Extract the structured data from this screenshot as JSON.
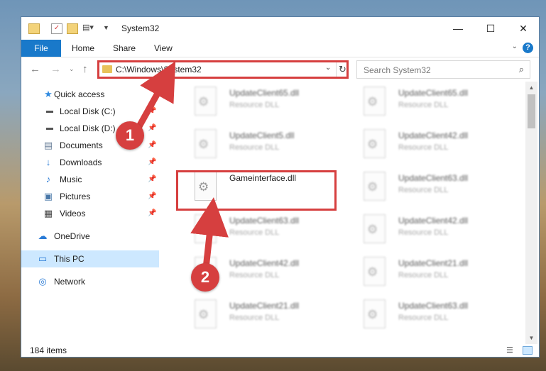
{
  "window": {
    "title": "System32"
  },
  "ribbon": {
    "file": "File",
    "tabs": [
      "Home",
      "Share",
      "View"
    ],
    "help": "?"
  },
  "address": {
    "path": "C:\\Windows\\System32",
    "search_placeholder": "Search System32"
  },
  "nav": {
    "items": [
      {
        "label": "Quick access",
        "icon": "star-icon",
        "pinned": false,
        "selected": false
      },
      {
        "label": "Local Disk (C:)",
        "icon": "drive-icon",
        "pinned": true,
        "selected": false
      },
      {
        "label": "Local Disk (D:)",
        "icon": "drive-icon",
        "pinned": true,
        "selected": false
      },
      {
        "label": "Documents",
        "icon": "document-icon",
        "pinned": true,
        "selected": false
      },
      {
        "label": "Downloads",
        "icon": "download-icon",
        "pinned": true,
        "selected": false
      },
      {
        "label": "Music",
        "icon": "music-icon",
        "pinned": true,
        "selected": false
      },
      {
        "label": "Pictures",
        "icon": "picture-icon",
        "pinned": true,
        "selected": false
      },
      {
        "label": "Videos",
        "icon": "video-icon",
        "pinned": true,
        "selected": false
      },
      {
        "label": "OneDrive",
        "icon": "cloud-icon",
        "pinned": false,
        "selected": false
      },
      {
        "label": "This PC",
        "icon": "computer-icon",
        "pinned": false,
        "selected": true
      },
      {
        "label": "Network",
        "icon": "network-icon",
        "pinned": false,
        "selected": false
      }
    ]
  },
  "files": [
    {
      "name": "UpdateClient65.dll",
      "desc": "Resource DLL",
      "blurred": true
    },
    {
      "name": "UpdateClient65.dll",
      "desc": "Resource DLL",
      "blurred": true
    },
    {
      "name": "UpdateClient5.dll",
      "desc": "Resource DLL",
      "blurred": true
    },
    {
      "name": "UpdateClient42.dll",
      "desc": "Resource DLL",
      "blurred": true
    },
    {
      "name": "Gameinterface.dll",
      "desc": "",
      "blurred": false
    },
    {
      "name": "UpdateClient63.dll",
      "desc": "Resource DLL",
      "blurred": true
    },
    {
      "name": "UpdateClient63.dll",
      "desc": "Resource DLL",
      "blurred": true
    },
    {
      "name": "UpdateClient42.dll",
      "desc": "Resource DLL",
      "blurred": true
    },
    {
      "name": "UpdateClient42.dll",
      "desc": "Resource DLL",
      "blurred": true
    },
    {
      "name": "UpdateClient21.dll",
      "desc": "Resource DLL",
      "blurred": true
    },
    {
      "name": "UpdateClient21.dll",
      "desc": "Resource DLL",
      "blurred": true
    },
    {
      "name": "UpdateClient63.dll",
      "desc": "Resource DLL",
      "blurred": true
    }
  ],
  "status": {
    "count": "184 items"
  },
  "annotations": {
    "badge1": "1",
    "badge2": "2",
    "color": "#d63f3f"
  }
}
